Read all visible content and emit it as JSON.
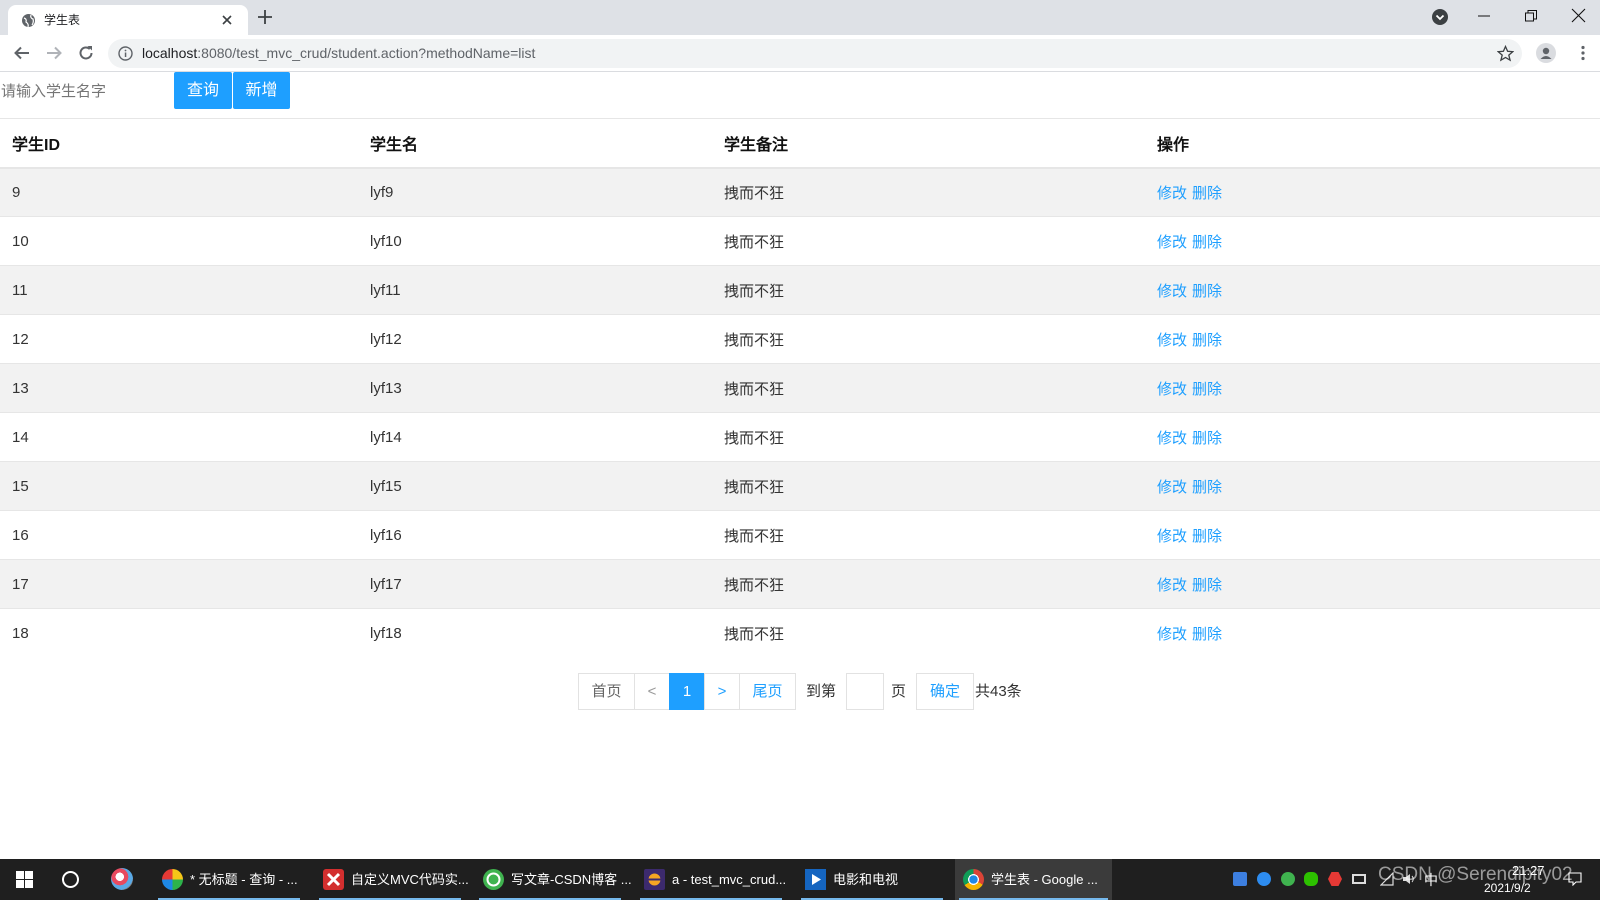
{
  "browser": {
    "tab_title": "学生表",
    "url_host": "localhost",
    "url_rest": ":8080/test_mvc_crud/student.action?methodName=list",
    "icons": [
      "globe-icon",
      "tab-close-icon",
      "new-tab-plus-icon",
      "tab-search-icon",
      "minimize-icon",
      "restore-icon",
      "window-close-icon",
      "back-arrow-icon",
      "forward-arrow-icon",
      "reload-icon",
      "site-info-icon",
      "bookmark-star-icon",
      "profile-icon",
      "menu-dots-icon"
    ]
  },
  "search": {
    "placeholder": "请输入学生名字",
    "value": "",
    "query_label": "查询",
    "add_label": "新增"
  },
  "table": {
    "headers": [
      "学生ID",
      "学生名",
      "学生备注",
      "操作"
    ],
    "rows": [
      {
        "id": "9",
        "name": "lyf9",
        "remark": "拽而不狂",
        "edit": "修改",
        "delete": "删除"
      },
      {
        "id": "10",
        "name": "lyf10",
        "remark": "拽而不狂",
        "edit": "修改",
        "delete": "删除"
      },
      {
        "id": "11",
        "name": "lyf11",
        "remark": "拽而不狂",
        "edit": "修改",
        "delete": "删除"
      },
      {
        "id": "12",
        "name": "lyf12",
        "remark": "拽而不狂",
        "edit": "修改",
        "delete": "删除"
      },
      {
        "id": "13",
        "name": "lyf13",
        "remark": "拽而不狂",
        "edit": "修改",
        "delete": "删除"
      },
      {
        "id": "14",
        "name": "lyf14",
        "remark": "拽而不狂",
        "edit": "修改",
        "delete": "删除"
      },
      {
        "id": "15",
        "name": "lyf15",
        "remark": "拽而不狂",
        "edit": "修改",
        "delete": "删除"
      },
      {
        "id": "16",
        "name": "lyf16",
        "remark": "拽而不狂",
        "edit": "修改",
        "delete": "删除"
      },
      {
        "id": "17",
        "name": "lyf17",
        "remark": "拽而不狂",
        "edit": "修改",
        "delete": "删除"
      },
      {
        "id": "18",
        "name": "lyf18",
        "remark": "拽而不狂",
        "edit": "修改",
        "delete": "删除"
      }
    ]
  },
  "pagination": {
    "first": "首页",
    "prev": "<",
    "current": "1",
    "next": ">",
    "last": "尾页",
    "goto_prefix": "到第",
    "goto_value": "",
    "goto_suffix": "页",
    "confirm": "确定",
    "total": "共43条"
  },
  "taskbar": {
    "icons": [
      "windows-start-icon",
      "cortana-search-icon",
      "pinned-app-icon"
    ],
    "apps": [
      {
        "label": "* 无标题 - 查询 - ...",
        "icon": "navicat-icon",
        "active": false
      },
      {
        "label": "自定义MVC代码实...",
        "icon": "xmind-icon",
        "active": false
      },
      {
        "label": "写文章-CSDN博客 ...",
        "icon": "browser-360-icon",
        "active": false
      },
      {
        "label": "a - test_mvc_crud...",
        "icon": "eclipse-icon",
        "active": false
      },
      {
        "label": "电影和电视",
        "icon": "movies-tv-icon",
        "active": false
      },
      {
        "label": "学生表 - Google ...",
        "icon": "chrome-icon",
        "active": true
      }
    ],
    "tray_icons": [
      "tray-app-icon",
      "tray-bird-icon",
      "tray-green-icon",
      "wechat-icon",
      "tray-security-icon",
      "battery-icon",
      "network-icon",
      "volume-icon",
      "notification-icon"
    ],
    "ime": "中",
    "time": "21:27",
    "date": "2021/9/2"
  },
  "watermark": "CSDN @Serendipity02",
  "colors": {
    "accent": "#1E9FFF",
    "row_stripe": "#f2f2f2",
    "tabstrip": "#dee1e6",
    "taskbar": "#1f1f1f"
  }
}
